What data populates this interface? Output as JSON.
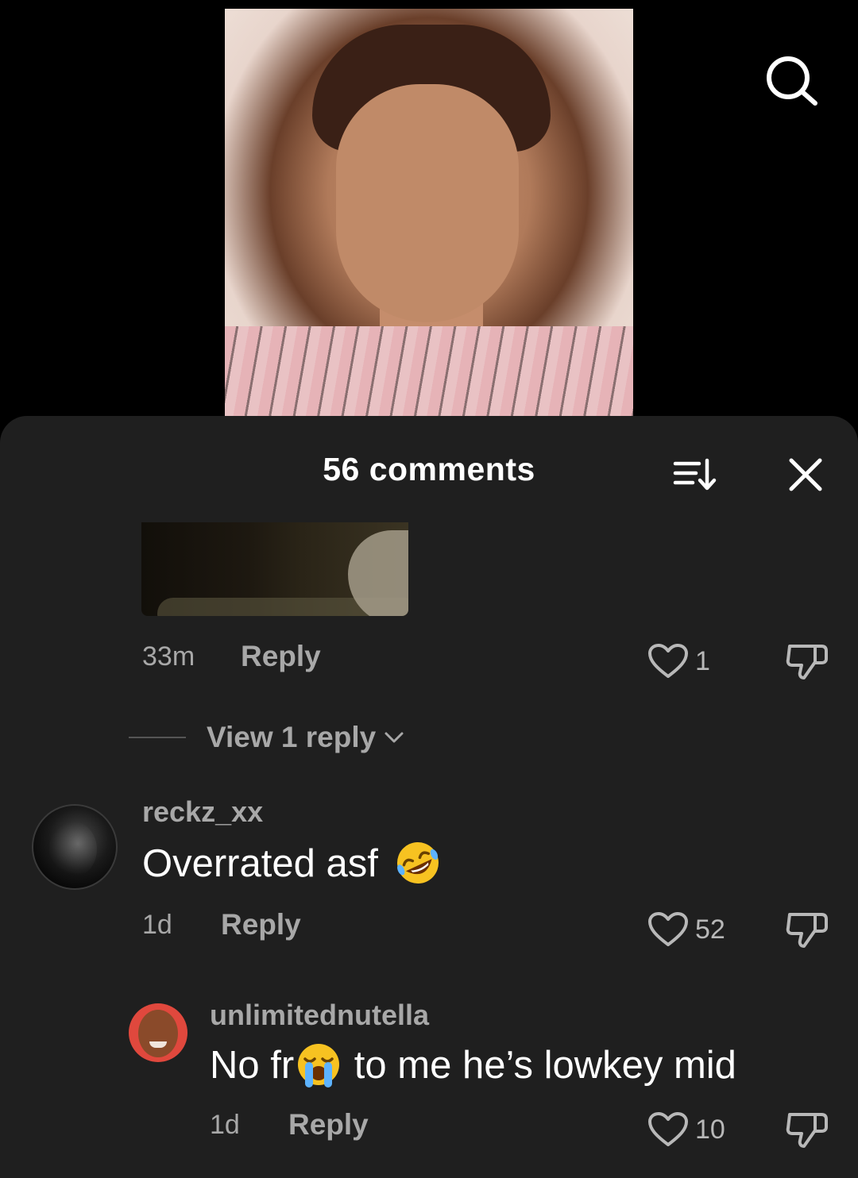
{
  "header": {
    "search_icon": "search-icon"
  },
  "sheet": {
    "title": "56 comments",
    "sort_icon": "sort-icon",
    "close_icon": "close-icon"
  },
  "comments": [
    {
      "time": "33m",
      "reply_label": "Reply",
      "likes": "1",
      "view_replies_label": "View 1 reply"
    },
    {
      "username": "reckz_xx",
      "text": "Overrated asf",
      "emoji": "rolling-on-floor-laughing",
      "time": "1d",
      "reply_label": "Reply",
      "likes": "52"
    },
    {
      "username": "unlimitednutella",
      "text_before": "No fr",
      "emoji": "loudly-crying-face",
      "text_after": " to me he’s lowkey mid",
      "time": "1d",
      "reply_label": "Reply",
      "likes": "10"
    }
  ],
  "colors": {
    "background": "#000000",
    "sheet": "#1f1f1f",
    "muted_text": "#a8a8a8",
    "primary_text": "#ffffff"
  }
}
